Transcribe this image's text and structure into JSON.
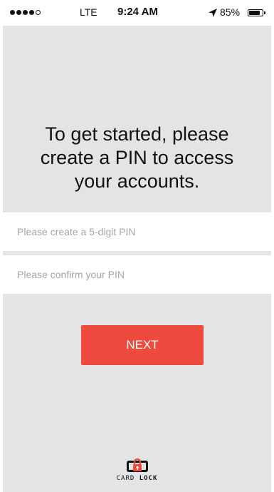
{
  "status_bar": {
    "signal_filled": 4,
    "signal_total": 5,
    "carrier": "LTE",
    "time": "9:24 AM",
    "location_icon": "location-arrow-icon",
    "battery_percent_text": "85%",
    "battery_level": 0.85
  },
  "headline": {
    "line1": "To get started, please",
    "line2": "create a PIN to access",
    "line3": "your accounts."
  },
  "form": {
    "pin_placeholder": "Please create a 5-digit PIN",
    "pin_value": "",
    "confirm_placeholder": "Please confirm your PIN",
    "confirm_value": ""
  },
  "button": {
    "next_label": "NEXT"
  },
  "logo": {
    "name_part1": "CARD ",
    "name_part2": "LOCK",
    "icon": "lock-card-icon"
  },
  "colors": {
    "background": "#e3e4e6",
    "accent": "#ef4a3e",
    "text": "#111111",
    "placeholder": "#a2a4a8"
  }
}
